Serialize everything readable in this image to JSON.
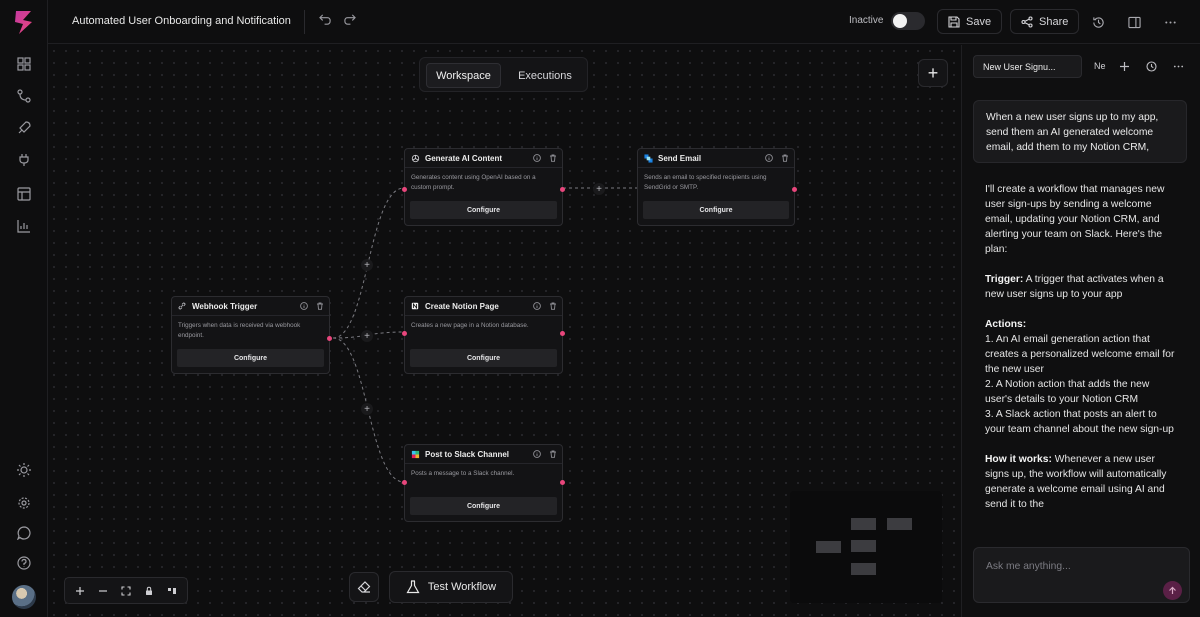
{
  "app": {
    "title": "Automated User Onboarding and Notification"
  },
  "toolbar": {
    "status_label": "Inactive",
    "save_label": "Save",
    "share_label": "Share"
  },
  "canvas": {
    "tabs": [
      {
        "label": "Workspace",
        "active": true
      },
      {
        "label": "Executions",
        "active": false
      }
    ],
    "test_label": "Test Workflow",
    "nodes": [
      {
        "id": "webhook",
        "title": "Webhook Trigger",
        "icon": "link-icon",
        "desc": "Triggers when data is received via webhook endpoint.",
        "button": "Configure"
      },
      {
        "id": "ai",
        "title": "Generate AI Content",
        "icon": "openai-icon",
        "desc": "Generates content using OpenAI based on a custom prompt.",
        "button": "Configure"
      },
      {
        "id": "email",
        "title": "Send Email",
        "icon": "sendgrid-icon",
        "desc": "Sends an email to specified recipients using SendGrid or SMTP.",
        "button": "Configure"
      },
      {
        "id": "notion",
        "title": "Create Notion Page",
        "icon": "notion-icon",
        "desc": "Creates a new page in a Notion database.",
        "button": "Configure"
      },
      {
        "id": "slack",
        "title": "Post to Slack Channel",
        "icon": "slack-icon",
        "desc": "Posts a message to a Slack channel.",
        "button": "Configure"
      }
    ]
  },
  "panel": {
    "chat_tab": "New User Signu...",
    "chat_tab2": "Ne",
    "user_message": "When a new user signs up to my app, send them an AI generated welcome email, add them to my Notion CRM,",
    "ai": {
      "intro": "I'll create a workflow that manages new user sign-ups by sending a welcome email, updating your Notion CRM, and alerting your team on Slack. Here's the plan:",
      "trigger_label": "Trigger:",
      "trigger_text": " A trigger that activates when a new user signs up to your app",
      "actions_label": "Actions:",
      "actions": [
        "1. An AI email generation action that creates a personalized welcome email for the new user",
        "2. A Notion action that adds the new user's details to your Notion CRM",
        "3. A Slack action that posts an alert to your team channel about the new sign-up"
      ],
      "how_label": "How it works:",
      "how_text": " Whenever a new user signs up, the workflow will automatically generate a welcome email using AI and send it to the"
    },
    "ask_placeholder": "Ask me anything..."
  },
  "colors": {
    "accent": "#e8467c",
    "background": "#0e0e0f"
  }
}
